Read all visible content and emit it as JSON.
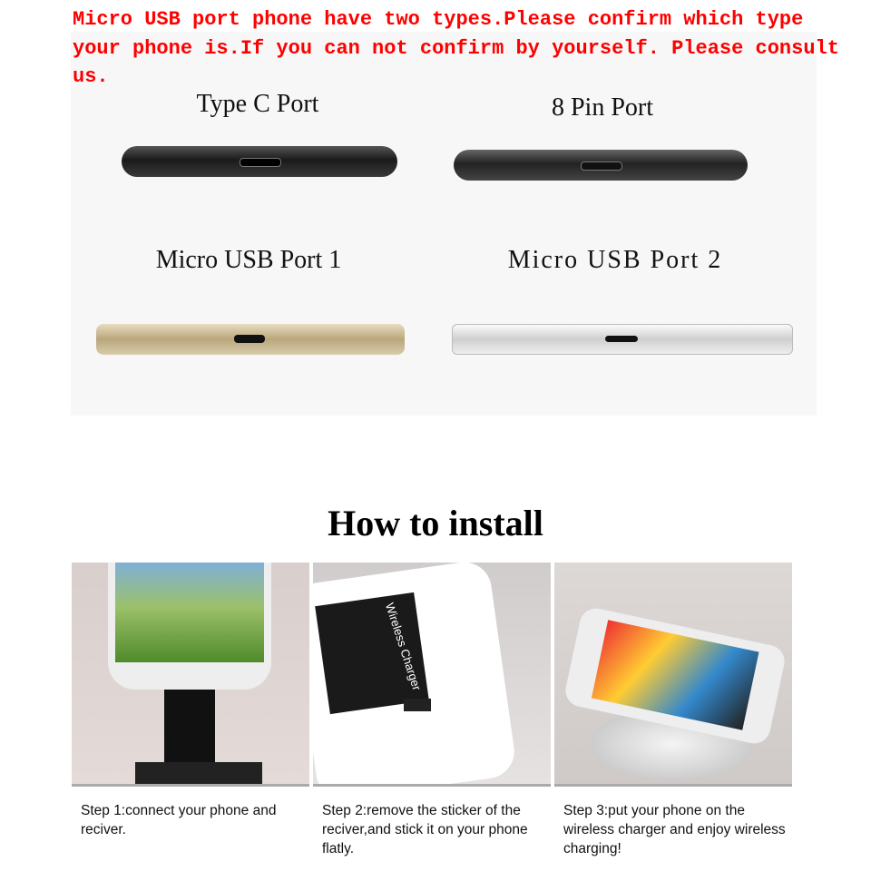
{
  "notice": "Micro USB port phone have two types.Please confirm which type your phone is.If you can not confirm by yourself. Please consult us.",
  "ports": [
    {
      "label": "Type C Port"
    },
    {
      "label": "8 Pin Port"
    },
    {
      "label": "Micro USB Port 1"
    },
    {
      "label": "Micro USB Port 2"
    }
  ],
  "install_title": "How to install",
  "steps": [
    {
      "caption": "Step 1:connect your phone and reciver."
    },
    {
      "caption": "Step 2:remove the sticker of the reciver,and stick it on your phone flatly.",
      "sticker_text": "Wireless Charger"
    },
    {
      "caption": "Step 3:put your phone on the wireless charger and enjoy wireless charging!"
    }
  ]
}
